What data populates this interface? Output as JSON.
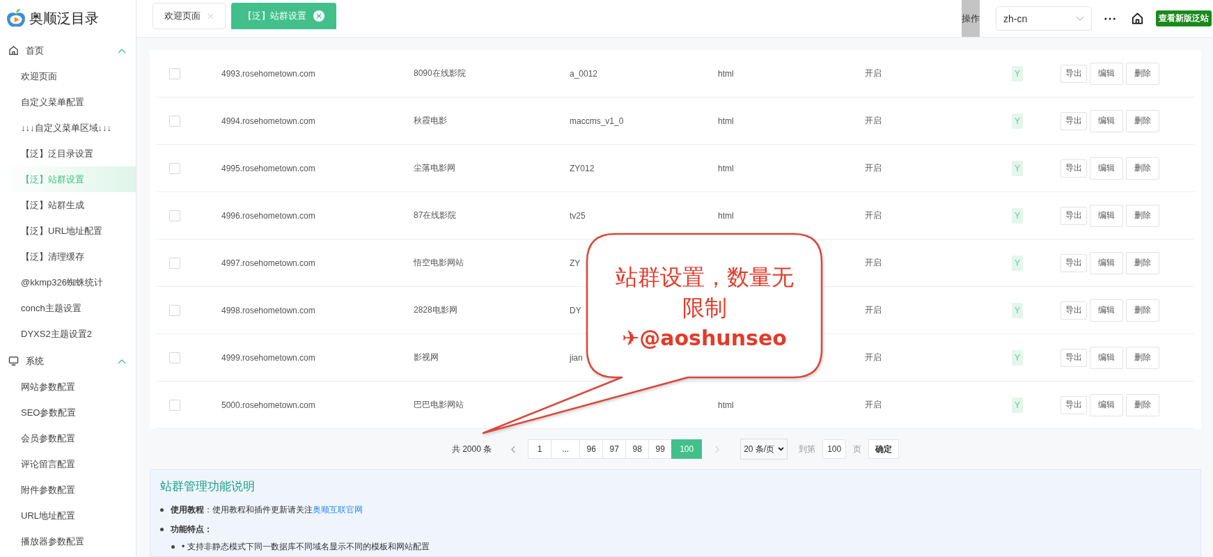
{
  "app": {
    "logo_text": "奥顺泛目录"
  },
  "tabs": [
    {
      "label": "欢迎页面",
      "selected": false
    },
    {
      "label": "【泛】站群设置",
      "selected": true
    }
  ],
  "header": {
    "column_label": "操作",
    "language": "zh-cn",
    "new_version_button": "查看新版泛站"
  },
  "sidebar": {
    "groups": [
      {
        "label": "首页",
        "expanded": true,
        "items": [
          {
            "label": "欢迎页面",
            "selected": false
          },
          {
            "label": "自定义菜单配置",
            "selected": false
          },
          {
            "label": "↓↓↓自定义菜单区域↓↓↓",
            "selected": false
          },
          {
            "label": "【泛】泛目录设置",
            "selected": false
          },
          {
            "label": "【泛】站群设置",
            "selected": true
          },
          {
            "label": "【泛】站群生成",
            "selected": false
          },
          {
            "label": "【泛】URL地址配置",
            "selected": false
          },
          {
            "label": "【泛】清理缓存",
            "selected": false
          },
          {
            "label": "@kkmp326蜘蛛统计",
            "selected": false
          },
          {
            "label": "conch主题设置",
            "selected": false
          },
          {
            "label": "DYXS2主题设置2",
            "selected": false
          }
        ]
      },
      {
        "label": "系统",
        "expanded": true,
        "items": [
          {
            "label": "网站参数配置",
            "selected": false
          },
          {
            "label": "SEO参数配置",
            "selected": false
          },
          {
            "label": "会员参数配置",
            "selected": false
          },
          {
            "label": "评论留言配置",
            "selected": false
          },
          {
            "label": "附件参数配置",
            "selected": false
          },
          {
            "label": "URL地址配置",
            "selected": false
          },
          {
            "label": "播放器参数配置",
            "selected": false
          }
        ]
      }
    ]
  },
  "table": {
    "rows": [
      {
        "checked": false,
        "domain": "4993.rosehometown.com",
        "name": "8090在线影院",
        "template": "a_0012",
        "type": "html",
        "status": "开启",
        "flag": "Y",
        "actions": [
          "导出",
          "编辑",
          "删除"
        ]
      },
      {
        "checked": false,
        "domain": "4994.rosehometown.com",
        "name": "秋霞电影",
        "template": "maccms_v1_0",
        "type": "html",
        "status": "开启",
        "flag": "Y",
        "actions": [
          "导出",
          "编辑",
          "删除"
        ]
      },
      {
        "checked": false,
        "domain": "4995.rosehometown.com",
        "name": "尘落电影网",
        "template": "ZY012",
        "type": "html",
        "status": "开启",
        "flag": "Y",
        "actions": [
          "导出",
          "编辑",
          "删除"
        ]
      },
      {
        "checked": false,
        "domain": "4996.rosehometown.com",
        "name": "87在线影院",
        "template": "tv25",
        "type": "html",
        "status": "开启",
        "flag": "Y",
        "actions": [
          "导出",
          "编辑",
          "删除"
        ]
      },
      {
        "checked": false,
        "domain": "4997.rosehometown.com",
        "name": "悟空电影网站",
        "template": "ZY",
        "status": "开启",
        "flag": "Y",
        "actions": [
          "导出",
          "编辑",
          "删除"
        ]
      },
      {
        "checked": false,
        "domain": "4998.rosehometown.com",
        "name": "2828电影网",
        "template": "DY",
        "status": "开启",
        "flag": "Y",
        "actions": [
          "导出",
          "编辑",
          "删除"
        ]
      },
      {
        "checked": false,
        "domain": "4999.rosehometown.com",
        "name": "影视网",
        "template": "jian",
        "status": "开启",
        "flag": "Y",
        "actions": [
          "导出",
          "编辑",
          "删除"
        ]
      },
      {
        "checked": false,
        "domain": "5000.rosehometown.com",
        "name": "巴巴电影网站",
        "type": "html",
        "status": "开启",
        "flag": "Y",
        "actions": [
          "导出",
          "编辑",
          "删除"
        ]
      }
    ]
  },
  "pagination": {
    "total": "共 2000 条",
    "pages": [
      {
        "label": "1",
        "selected": false
      },
      {
        "label": "...",
        "selected": false
      },
      {
        "label": "96",
        "selected": false
      },
      {
        "label": "97",
        "selected": false
      },
      {
        "label": "98",
        "selected": false
      },
      {
        "label": "99",
        "selected": false
      },
      {
        "label": "100",
        "selected": true
      }
    ],
    "page_size": "20 条/页",
    "goto_label": "到第",
    "goto_value": "100",
    "page_label": "页",
    "confirm": "确定"
  },
  "info": {
    "title": "站群管理功能说明",
    "items": [
      {
        "text": "**使用教程**：使用教程和插件更新请关注",
        "link": "奥顺互联官网"
      },
      {
        "text": "**功能特点：**"
      }
    ],
    "sub_items": [
      "• 支持非静态模式下同一数据库不同域名显示不同的模板和网站配置"
    ]
  },
  "callout": {
    "text": "站群设置，数量无限制",
    "handle": "✈@aoshunseo"
  }
}
